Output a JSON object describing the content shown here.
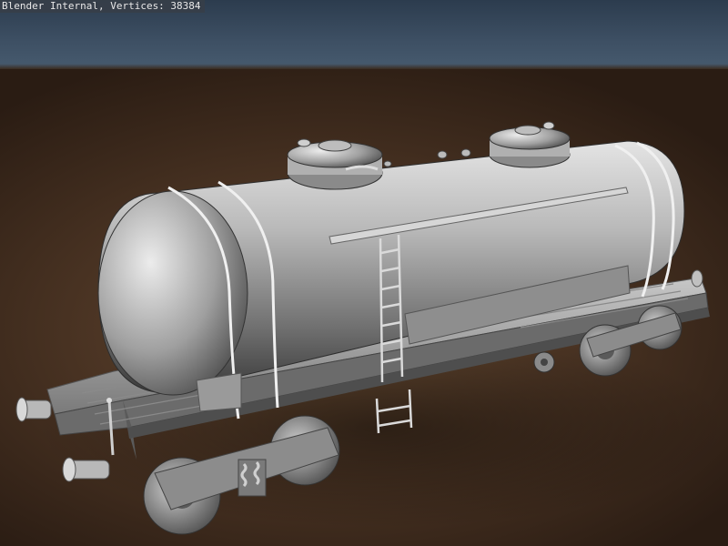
{
  "render_info": {
    "text": "Blender Internal, Vertices: 38384"
  },
  "colors": {
    "sky": "#3d4f63",
    "ground": "#4c3524",
    "model_light": "#e2e2e2",
    "model_mid": "#9a9a9a",
    "model_dark": "#3c3c3c"
  }
}
